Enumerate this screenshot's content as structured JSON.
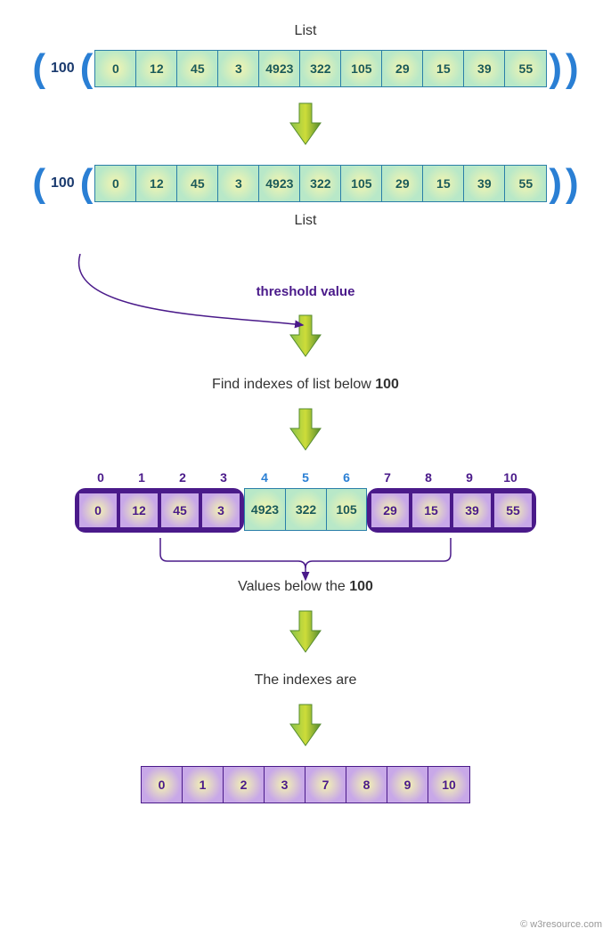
{
  "title_top": "List",
  "threshold": "100",
  "list": [
    "0",
    "12",
    "45",
    "3",
    "4923",
    "322",
    "105",
    "29",
    "15",
    "39",
    "55"
  ],
  "title_below": "List",
  "threshold_label": "threshold value",
  "find_text_a": "Find indexes of list below ",
  "find_text_b": "100",
  "indexes": [
    "0",
    "1",
    "2",
    "3",
    "4",
    "5",
    "6",
    "7",
    "8",
    "9",
    "10"
  ],
  "index_colors": [
    "p",
    "p",
    "p",
    "p",
    "b",
    "b",
    "b",
    "p",
    "p",
    "p",
    "p"
  ],
  "group_left": [
    "0",
    "12",
    "45",
    "3"
  ],
  "group_mid": [
    "4923",
    "322",
    "105"
  ],
  "group_right": [
    "29",
    "15",
    "39",
    "55"
  ],
  "values_below_a": "Values below the ",
  "values_below_b": "100",
  "indexes_are": "The indexes are",
  "result": [
    "0",
    "1",
    "2",
    "3",
    "7",
    "8",
    "9",
    "10"
  ],
  "watermark": "© w3resource.com"
}
